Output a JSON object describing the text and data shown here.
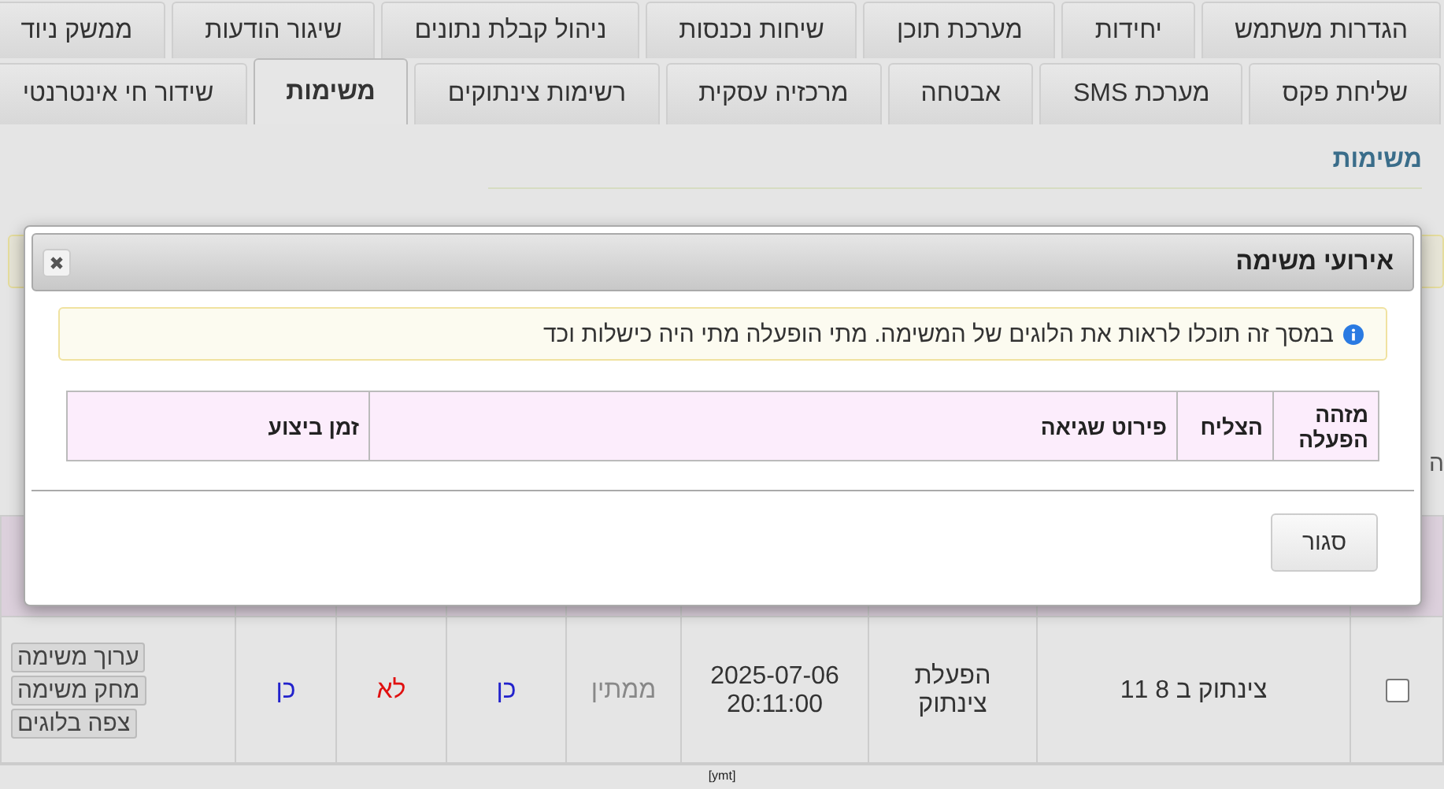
{
  "tabs_top": [
    {
      "label": "הגדרות משתמש",
      "selected": false
    },
    {
      "label": "יחידות",
      "selected": false
    },
    {
      "label": "מערכת תוכן",
      "selected": false
    },
    {
      "label": "שיחות נכנסות",
      "selected": false
    },
    {
      "label": "ניהול קבלת נתונים",
      "selected": false
    },
    {
      "label": "שיגור הודעות",
      "selected": false
    },
    {
      "label": "ממשק ניוד",
      "selected": false
    }
  ],
  "tabs_bottom": [
    {
      "label": "שליחת פקס",
      "selected": false
    },
    {
      "label": "מערכת SMS",
      "selected": false
    },
    {
      "label": "אבטחה",
      "selected": false
    },
    {
      "label": "מרכזיה עסקית",
      "selected": false
    },
    {
      "label": "רשימות צינתוקים",
      "selected": false
    },
    {
      "label": "משימות",
      "selected": true
    },
    {
      "label": "שידור חי אינטרנטי",
      "selected": false
    }
  ],
  "page": {
    "heading": "משימות",
    "side_fragment": "ה",
    "table": {
      "row": {
        "checked": false,
        "cells": [
          {
            "kind": "text",
            "text": "צינתוק ב 8 11"
          },
          {
            "kind": "text",
            "text": "הפעלת צינתוק"
          },
          {
            "kind": "text",
            "text": "2025-07-06 20:11:00"
          },
          {
            "kind": "muted",
            "text": "ממתין"
          },
          {
            "kind": "yes",
            "text": "כן"
          },
          {
            "kind": "no",
            "text": "לא"
          },
          {
            "kind": "yes",
            "text": "כן"
          }
        ],
        "actions": [
          "ערוך משימה",
          "מחק משימה",
          "צפה בלוגים"
        ]
      }
    },
    "footer": "[ymt]"
  },
  "dialog": {
    "title": "אירועי משימה",
    "info": "במסך זה תוכלו לראות את הלוגים של המשימה. מתי הופעלה מתי היה כישלות וכד",
    "columns": [
      "מזהה הפעלה",
      "הצליח",
      "פירוט שגיאה",
      "זמן ביצוע"
    ],
    "close_button": "סגור"
  }
}
